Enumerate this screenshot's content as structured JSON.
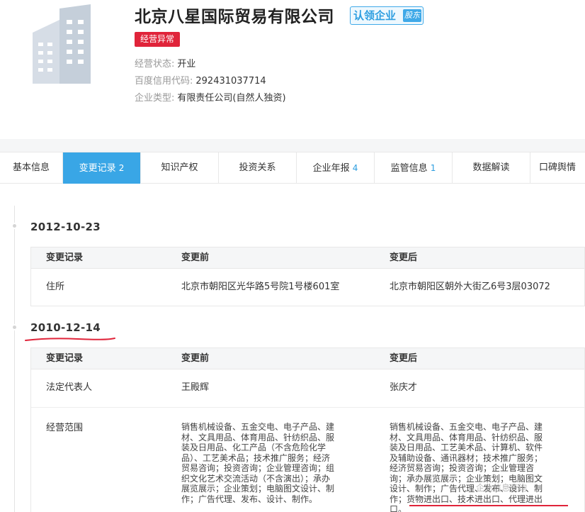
{
  "company": {
    "name": "北京八星国际贸易有限公司",
    "claim_label": "认领企业",
    "claim_tag": "股东",
    "abnormal_label": "经营异常",
    "info": [
      {
        "label": "经营状态:",
        "value": "开业"
      },
      {
        "label": "百度信用代码:",
        "value": "292431037714"
      },
      {
        "label": "企业类型:",
        "value": "有限责任公司(自然人独资)"
      }
    ]
  },
  "tabs": [
    {
      "label": "基本信息",
      "count": ""
    },
    {
      "label": "变更记录",
      "count": "2",
      "active": true
    },
    {
      "label": "知识产权",
      "count": ""
    },
    {
      "label": "投资关系",
      "count": ""
    },
    {
      "label": "企业年报",
      "count": "4"
    },
    {
      "label": "监管信息",
      "count": "1"
    },
    {
      "label": "数据解读",
      "count": ""
    },
    {
      "label": "口碑舆情",
      "count": ""
    }
  ],
  "records": [
    {
      "date": "2012-10-23",
      "headers": [
        "变更记录",
        "变更前",
        "变更后"
      ],
      "rows": [
        {
          "item": "住所",
          "before": "北京市朝阳区光华路5号院1号楼601室",
          "after": "北京市朝阳区朝外大街乙6号3层03072"
        }
      ]
    },
    {
      "date": "2010-12-14",
      "headers": [
        "变更记录",
        "变更前",
        "变更后"
      ],
      "rows": [
        {
          "item": "法定代表人",
          "before": "王殿辉",
          "after": "张庆才"
        },
        {
          "item": "经营范围",
          "before_lines": [
            "销售机械设备、五金交电、电子产品、建",
            "材、文具用品、体育用品、针纺织品、服",
            "装及日用品、化工产品（不含危险化学",
            "品）、工艺美术品；技术推广服务；经济",
            "贸易咨询；投资咨询；企业管理咨询；组",
            "织文化艺术交流活动（不含演出）；承办",
            "展览展示；企业策划；电脑图文设计、制",
            "作；广告代理、发布、设计、制作。"
          ],
          "after_lines": [
            "销售机械设备、五金交电、电子产品、建",
            "材、文具用品、体育用品、针纺织品、服",
            "装及日用品、工艺美术品、计算机、软件",
            "及辅助设备、通讯器材；技术推广服务；",
            "经济贸易咨询；投资咨询；企业管理咨",
            "询；承办展览展示；企业策划；电脑图文",
            "设计、制作；广告代理、发布、设计、制",
            "作；货物进出口、技术进出口、代理进出",
            "口。"
          ]
        }
      ]
    }
  ],
  "watermark": "企业信息查询",
  "colors": {
    "accent": "#39a6e6",
    "alert": "#e0243a",
    "annotation": "#e0243a"
  }
}
